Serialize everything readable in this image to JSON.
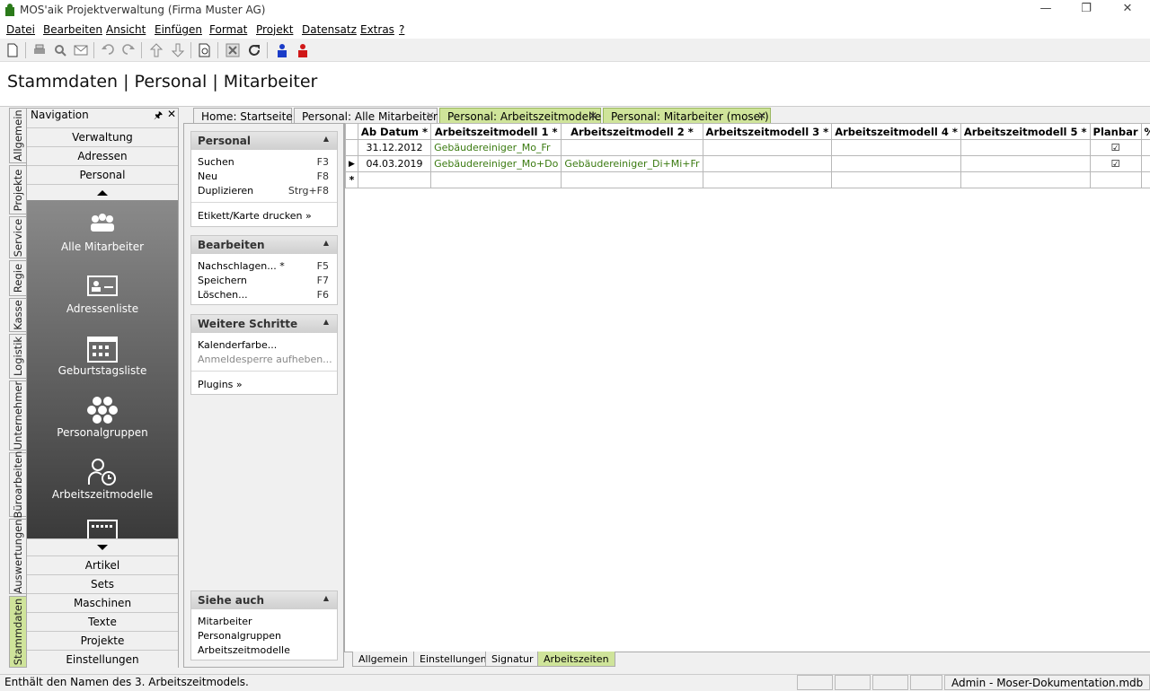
{
  "window": {
    "title": "MOS'aik Projektverwaltung (Firma Muster AG)",
    "minimize": "—",
    "restore": "❐",
    "close": "✕"
  },
  "menu": [
    "Datei",
    "Bearbeiten",
    "Ansicht",
    "Einfügen",
    "Format",
    "Projekt",
    "Datensatz",
    "Extras",
    "?"
  ],
  "page_title": "Stammdaten | Personal | Mitarbeiter",
  "vertical_tabs": [
    "Allgemein",
    "Projekte",
    "Service",
    "Regie",
    "Kasse",
    "Logistik",
    "Unternehmer",
    "Büroarbeiten",
    "Auswertungen",
    "Stammdaten"
  ],
  "active_vertical_tab": "Stammdaten",
  "navigation": {
    "title": "Navigation",
    "pin": "🖈",
    "close": "✕",
    "top_buttons": [
      "Verwaltung",
      "Adressen",
      "Personal"
    ],
    "big_items": [
      "Alle Mitarbeiter",
      "Adressenliste",
      "Geburtstagsliste",
      "Personalgruppen",
      "Arbeitszeitmodelle"
    ],
    "bottom_buttons": [
      "Artikel",
      "Sets",
      "Maschinen",
      "Texte",
      "Projekte",
      "Einstellungen"
    ]
  },
  "tasks": {
    "personal": {
      "title": "Personal",
      "items": [
        {
          "label": "Suchen",
          "key": "F3"
        },
        {
          "label": "Neu",
          "key": "F8"
        },
        {
          "label": "Duplizieren",
          "key": "Strg+F8"
        }
      ],
      "extra": "Etikett/Karte drucken »"
    },
    "bearbeiten": {
      "title": "Bearbeiten",
      "items": [
        {
          "label": "Nachschlagen... *",
          "key": "F5"
        },
        {
          "label": "Speichern",
          "key": "F7"
        },
        {
          "label": "Löschen...",
          "key": "F6"
        }
      ]
    },
    "weitere": {
      "title": "Weitere Schritte",
      "items": [
        "Kalenderfarbe...",
        "Anmeldesperre aufheben..."
      ],
      "extra": "Plugins »"
    },
    "siehe": {
      "title": "Siehe auch",
      "items": [
        "Mitarbeiter",
        "Personalgruppen",
        "Arbeitszeitmodelle"
      ]
    }
  },
  "doc_tabs": [
    {
      "label": "Home: Startseite",
      "active": false,
      "closable": false
    },
    {
      "label": "Personal: Alle Mitarbeiter",
      "active": false,
      "closable": true
    },
    {
      "label": "Personal: Arbeitszeitmodelle",
      "active": true,
      "closable": true
    },
    {
      "label": "Personal: Mitarbeiter (moser)",
      "active": true,
      "closable": true
    }
  ],
  "grid": {
    "columns": [
      "Ab Datum *",
      "Arbeitszeitmodell 1 *",
      "Arbeitszeitmodell 2 *",
      "Arbeitszeitmodell 3 *",
      "Arbeitszeitmodell 4 *",
      "Arbeitszeitmodell 5 *",
      "Planbar",
      "%"
    ],
    "rows": [
      {
        "date": "31.12.2012",
        "m1": "Gebäudereiniger_Mo_Fr",
        "m2": "",
        "m3": "",
        "m4": "",
        "m5": "",
        "planbar": "☑",
        "pct": ""
      },
      {
        "date": "04.03.2019",
        "m1": "Gebäudereiniger_Mo+Do",
        "m2": "Gebäudereiniger_Di+Mi+Fr",
        "m3": "",
        "m4": "",
        "m5": "",
        "planbar": "☑",
        "pct": ""
      }
    ],
    "new_row_marker": "*",
    "current_row_marker": "▶"
  },
  "bottom_tabs": [
    "Allgemein",
    "Einstellungen",
    "Signatur",
    "Arbeitszeiten"
  ],
  "active_bottom_tab": "Arbeitszeiten",
  "status": {
    "text": "Enthält den Namen des 3. Arbeitszeitmodels.",
    "db": "Admin - Moser-Dokumentation.mdb"
  },
  "colors": {
    "accent_green": "#cfe49a",
    "link_green": "#3a7a10"
  }
}
